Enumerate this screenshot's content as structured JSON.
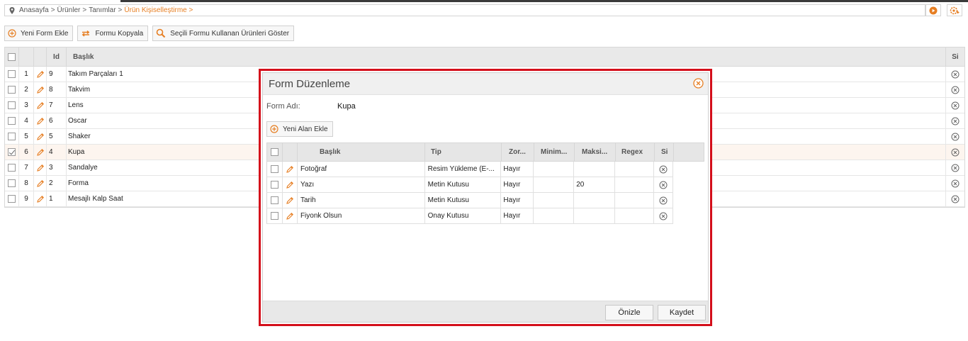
{
  "breadcrumb": {
    "items": [
      "Anasayfa",
      "Ürünler",
      "Tanımlar"
    ],
    "separator": ">",
    "active": "Ürün Kişiselleştirme >"
  },
  "toolbar": {
    "new_form": "Yeni Form Ekle",
    "copy_form": "Formu Kopyala",
    "show_products": "Seçili Formu Kullanan Ürünleri Göster"
  },
  "grid": {
    "headers": {
      "id": "Id",
      "title": "Başlık",
      "delete": "Si"
    },
    "rows": [
      {
        "num": "1",
        "id": "9",
        "title": "Takım Parçaları 1",
        "checked": false
      },
      {
        "num": "2",
        "id": "8",
        "title": "Takvim",
        "checked": false
      },
      {
        "num": "3",
        "id": "7",
        "title": "Lens",
        "checked": false
      },
      {
        "num": "4",
        "id": "6",
        "title": "Oscar",
        "checked": false
      },
      {
        "num": "5",
        "id": "5",
        "title": "Shaker",
        "checked": false
      },
      {
        "num": "6",
        "id": "4",
        "title": "Kupa",
        "checked": true
      },
      {
        "num": "7",
        "id": "3",
        "title": "Sandalye",
        "checked": false
      },
      {
        "num": "8",
        "id": "2",
        "title": "Forma",
        "checked": false
      },
      {
        "num": "9",
        "id": "1",
        "title": "Mesajlı Kalp Saat",
        "checked": false
      }
    ]
  },
  "modal": {
    "title": "Form Düzenleme",
    "form_label": "Form Adı:",
    "form_value": "Kupa",
    "add_field": "Yeni Alan Ekle",
    "headers": {
      "title": "Başlık",
      "type": "Tip",
      "required": "Zor...",
      "min": "Minim...",
      "max": "Maksi...",
      "regex": "Regex",
      "delete": "Si"
    },
    "rows": [
      {
        "title": "Fotoğraf",
        "type": "Resim Yükleme (E-...",
        "required": "Hayır",
        "min": "",
        "max": "",
        "regex": ""
      },
      {
        "title": "Yazı",
        "type": "Metin Kutusu",
        "required": "Hayır",
        "min": "",
        "max": "20",
        "regex": ""
      },
      {
        "title": "Tarih",
        "type": "Metin Kutusu",
        "required": "Hayır",
        "min": "",
        "max": "",
        "regex": ""
      },
      {
        "title": "Fiyonk Olsun",
        "type": "Onay Kutusu",
        "required": "Hayır",
        "min": "",
        "max": "",
        "regex": ""
      }
    ],
    "preview_label": "Önizle",
    "save_label": "Kaydet"
  },
  "colors": {
    "accent": "#e67e22",
    "modal_border": "#d40f1b",
    "header_bg": "#e9e9e9",
    "selected_row": "#fdf5ef"
  },
  "icons": {
    "location": "map-pin-icon",
    "add": "plus-circle-icon",
    "copy": "swap-arrows-icon",
    "search": "search-icon",
    "edit": "pencil-icon",
    "delete": "x-circle-icon",
    "close": "close-icon",
    "play": "play-circle-icon",
    "add_item": "add-gear-icon"
  }
}
